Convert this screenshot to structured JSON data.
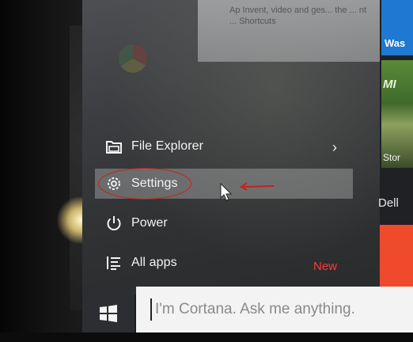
{
  "start_menu": {
    "items": [
      {
        "label": "File Explorer",
        "icon": "file-explorer-icon"
      },
      {
        "label": "Settings",
        "icon": "gear-icon"
      },
      {
        "label": "Power",
        "icon": "power-icon"
      },
      {
        "label": "All apps",
        "icon": "all-apps-icon"
      }
    ],
    "new_badge": "New",
    "expand_glyph": "›"
  },
  "tiles": {
    "tile_1_label": "Was",
    "tile_2_caption": "MI",
    "tile_2_store": "Stor",
    "group_label": "Dell"
  },
  "background_window": {
    "text": "Ap  Invent, video and ges... the ... nt ... Shortcuts"
  },
  "taskbar": {
    "search_placeholder": "I'm Cortana. Ask me anything.",
    "start_icon": "windows-logo-icon"
  },
  "colors": {
    "accent_red": "#f04a2c",
    "tile_blue": "#1f78d1",
    "new_badge": "#ff3b30",
    "annotation_red": "#c62020"
  }
}
